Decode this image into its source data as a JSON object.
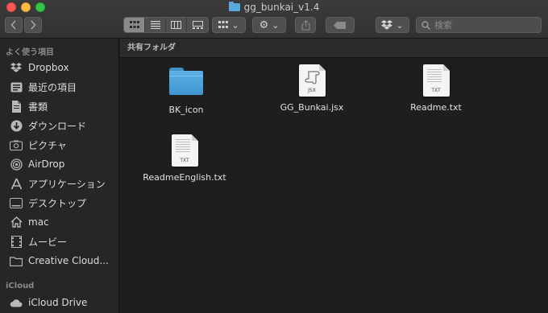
{
  "window": {
    "title": "gg_bunkai_v1.4",
    "title_icon": "folder-icon"
  },
  "toolbar": {
    "back_icon": "chevron-left-icon",
    "forward_icon": "chevron-right-icon",
    "view_modes": [
      "icon-view",
      "list-view",
      "column-view",
      "gallery-view"
    ],
    "active_view": "icon-view",
    "group_icon": "group-grid-icon",
    "action_icon": "gear-icon",
    "share_icon": "share-icon",
    "tag_icon": "tag-icon",
    "dropbox_icon": "dropbox-icon",
    "search_placeholder": "検索"
  },
  "sidebar": {
    "favorites_header": "よく使う項目",
    "favorites": [
      {
        "label": "Dropbox",
        "icon": "dropbox-icon"
      },
      {
        "label": "最近の項目",
        "icon": "recents-icon"
      },
      {
        "label": "書類",
        "icon": "documents-icon"
      },
      {
        "label": "ダウンロード",
        "icon": "downloads-icon"
      },
      {
        "label": "ピクチャ",
        "icon": "pictures-icon"
      },
      {
        "label": "AirDrop",
        "icon": "airdrop-icon"
      },
      {
        "label": "アプリケーション",
        "icon": "applications-icon"
      },
      {
        "label": "デスクトップ",
        "icon": "desktop-icon"
      },
      {
        "label": "mac",
        "icon": "home-icon"
      },
      {
        "label": "ムービー",
        "icon": "movies-icon"
      },
      {
        "label": "Creative Cloud...",
        "icon": "folder-icon"
      }
    ],
    "icloud_header": "iCloud",
    "icloud": [
      {
        "label": "iCloud Drive",
        "icon": "icloud-icon"
      }
    ]
  },
  "content": {
    "header": "共有フォルダ",
    "files": [
      {
        "name": "BK_icon",
        "type": "folder"
      },
      {
        "name": "GG_Bunkai.jsx",
        "type": "jsx",
        "badge": "JSX"
      },
      {
        "name": "Readme.txt",
        "type": "txt",
        "badge": "TXT"
      },
      {
        "name": "ReadmeEnglish.txt",
        "type": "txt",
        "badge": "TXT"
      }
    ]
  },
  "colors": {
    "folder_blue": "#5db3e6",
    "close": "#fc5753",
    "minimize": "#fdbc40",
    "zoom": "#33c748"
  }
}
